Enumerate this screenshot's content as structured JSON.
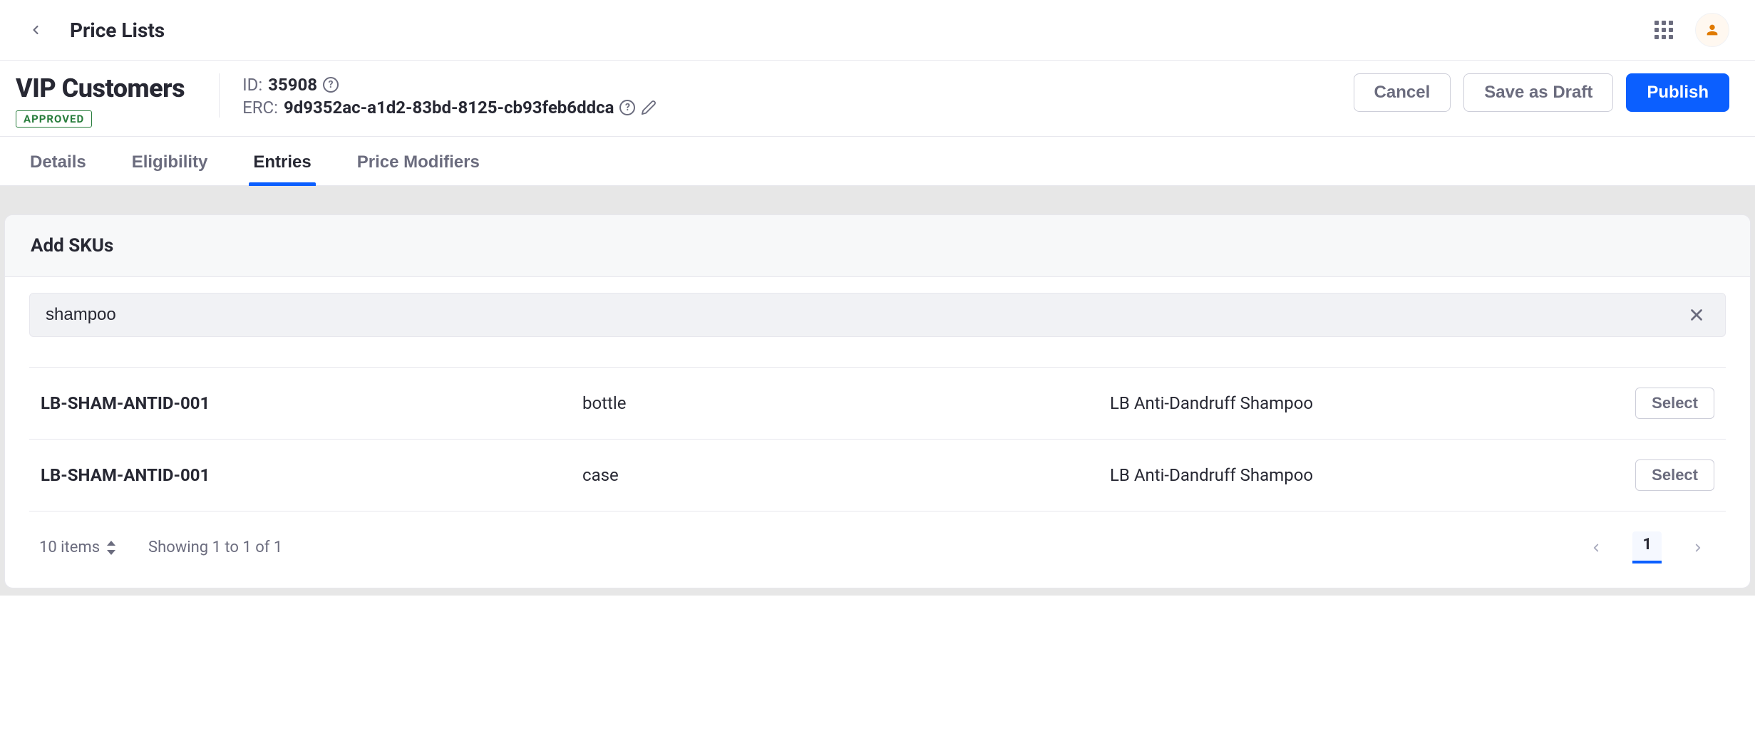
{
  "breadcrumb": {
    "title": "Price Lists"
  },
  "header": {
    "title": "VIP Customers",
    "status": "APPROVED",
    "id_label": "ID:",
    "id_value": "35908",
    "erc_label": "ERC:",
    "erc_value": "9d9352ac-a1d2-83bd-8125-cb93feb6ddca",
    "actions": {
      "cancel": "Cancel",
      "save_draft": "Save as Draft",
      "publish": "Publish"
    }
  },
  "tabs": {
    "details": "Details",
    "eligibility": "Eligibility",
    "entries": "Entries",
    "modifiers": "Price Modifiers"
  },
  "panel": {
    "title": "Add SKUs",
    "search_value": "shampoo",
    "results": [
      {
        "sku": "LB-SHAM-ANTID-001",
        "unit": "bottle",
        "name": "LB Anti-Dandruff Shampoo",
        "select_label": "Select"
      },
      {
        "sku": "LB-SHAM-ANTID-001",
        "unit": "case",
        "name": "LB Anti-Dandruff Shampoo",
        "select_label": "Select"
      }
    ],
    "footer": {
      "page_size_label": "10 items",
      "showing": "Showing 1 to 1 of 1",
      "current_page": "1"
    }
  }
}
